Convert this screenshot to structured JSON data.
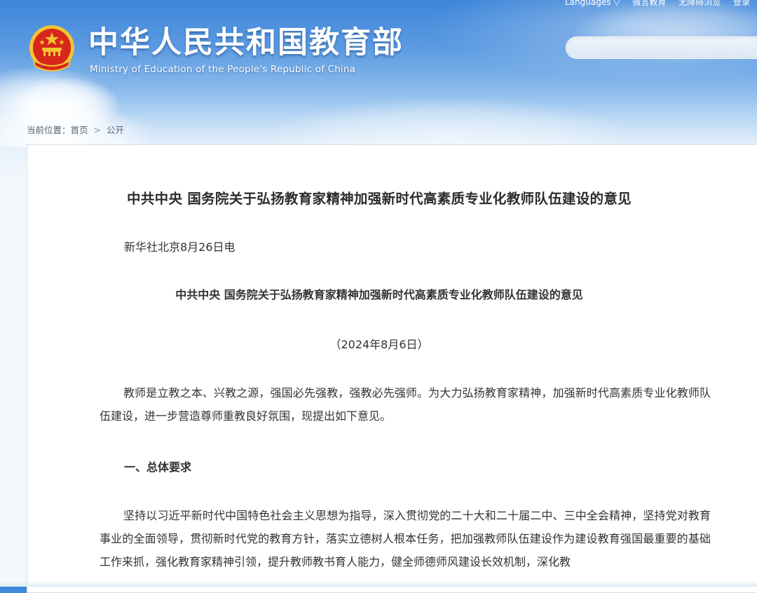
{
  "header": {
    "site_name": "中华人民共和国教育部",
    "site_name_en": "Ministry of Education of the People's Republic of China",
    "emblem_icon": "national-emblem-icon",
    "top_links": [
      "Languages ▽",
      "微言教育",
      "无障碍浏览",
      "登录"
    ],
    "search_placeholder": ""
  },
  "breadcrumb": {
    "label": "当前位置：",
    "home": "首页",
    "separator": ">",
    "current": "公开"
  },
  "article": {
    "title": "中共中央 国务院关于弘扬教育家精神加强新时代高素质专业化教师队伍建设的意见",
    "source": "新华社北京8月26日电",
    "subtitle": "中共中央 国务院关于弘扬教育家精神加强新时代高素质专业化教师队伍建设的意见",
    "date": "（2024年8月6日）",
    "paragraph_1": "教师是立教之本、兴教之源，强国必先强教，强教必先强师。为大力弘扬教育家精神，加强新时代高素质专业化教师队伍建设，进一步营造尊师重教良好氛围，现提出如下意见。",
    "section_1": "一、总体要求",
    "paragraph_2": "坚持以习近平新时代中国特色社会主义思想为指导，深入贯彻党的二十大和二十届二中、三中全会精神，坚持党对教育事业的全面领导，贯彻新时代党的教育方针，落实立德树人根本任务，把加强教师队伍建设作为建设教育强国最重要的基础工作来抓，强化教育家精神引领，提升教师教书育人能力，健全师德师风建设长效机制，深化教"
  },
  "colors": {
    "sky_top": "#3f86d9",
    "emblem_red": "#d7261c",
    "emblem_gold": "#f4c431"
  }
}
